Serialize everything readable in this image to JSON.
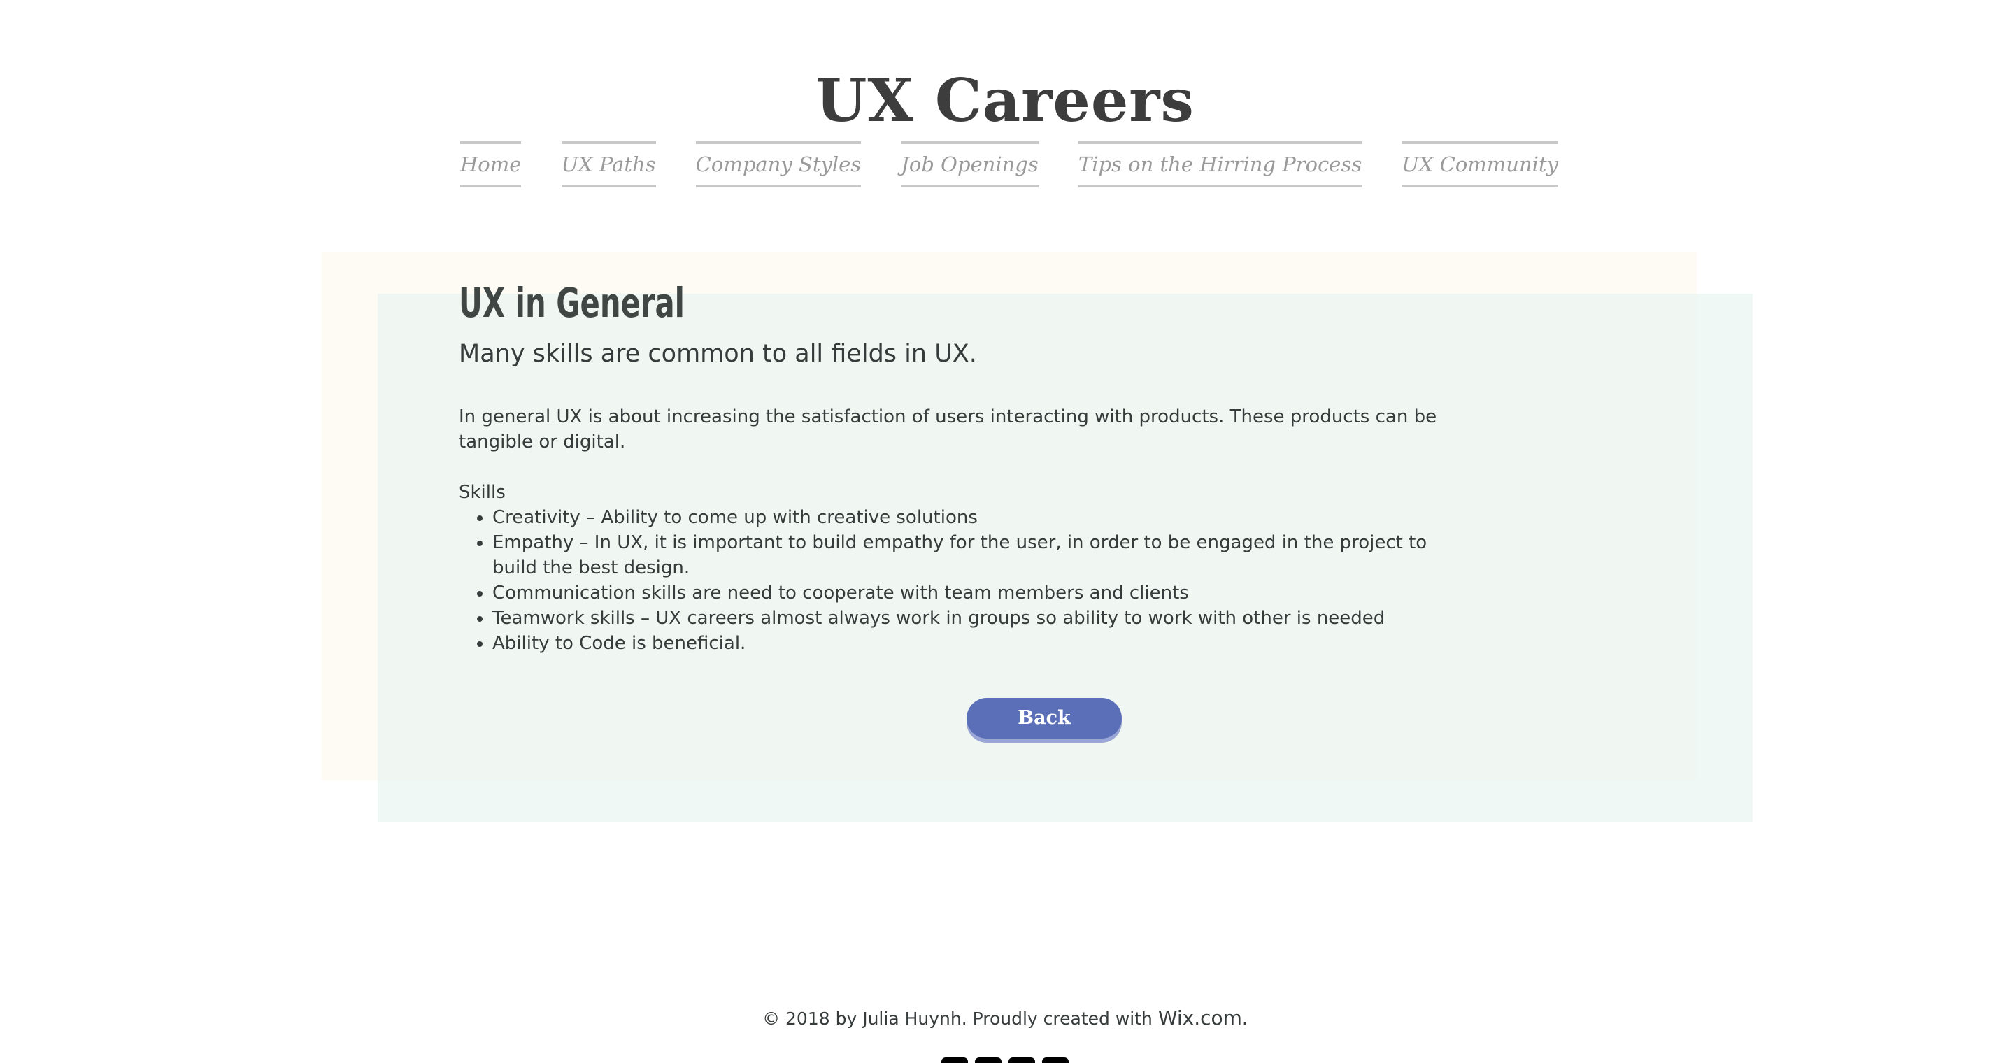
{
  "site": {
    "title": "UX Careers"
  },
  "nav": {
    "items": [
      {
        "label": "Home"
      },
      {
        "label": "UX Paths"
      },
      {
        "label": "Company Styles"
      },
      {
        "label": "Job Openings"
      },
      {
        "label": "Tips on the Hirring Process"
      },
      {
        "label": "UX Community"
      }
    ]
  },
  "main": {
    "heading": "UX in General",
    "subtitle": "Many skills are common to all fields in UX.",
    "paragraph": "In general UX is about increasing the satisfaction of users interacting with products. These products can be tangible or digital.",
    "skills_heading": "Skills",
    "skills": [
      "Creativity – Ability to come up with creative solutions",
      "Empathy – In UX, it is important to build empathy for the user, in order to be engaged in the project to build the best design.",
      "Communication skills are need to cooperate with team members and clients",
      "Teamwork skills – UX careers almost always work in groups so ability to work with other is needed",
      "Ability to Code is beneficial."
    ],
    "back_label": "Back"
  },
  "footer": {
    "text": "© 2018 by Julia Huynh. Proudly created with ",
    "link_text": "Wix.com",
    "suffix": "."
  },
  "social": {
    "icons": [
      "social-icon-1",
      "social-icon-2",
      "social-icon-3",
      "social-icon-4"
    ]
  },
  "colors": {
    "accent": "#5b6fb8",
    "panel_back": "#fefaf4",
    "panel_front": "#e6f3ef",
    "text": "#363b3b",
    "nav_text": "#9a9a9a"
  }
}
